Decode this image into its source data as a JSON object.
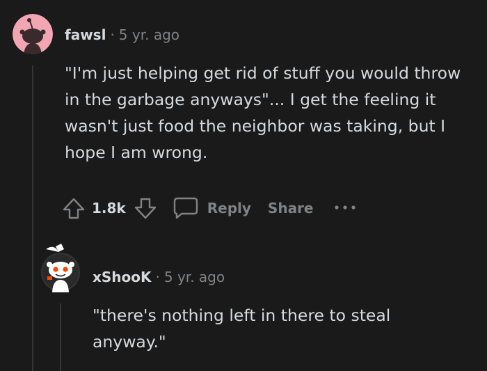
{
  "comments": [
    {
      "username": "fawsl",
      "separator": "·",
      "time": "5 yr. ago",
      "body": "\"I'm just helping get rid of stuff you would throw in the garbage anyways\"... I get the feeling it wasn't just food the neighbor was taking, but I hope I am wrong.",
      "score": "1.8k",
      "reply_label": "Reply",
      "share_label": "Share",
      "avatar_bg": "#f2a5b3",
      "icons": [
        "upvote-icon",
        "downvote-icon",
        "comment-icon",
        "more-icon"
      ]
    },
    {
      "username": "xShooK",
      "separator": "·",
      "time": "5 yr. ago",
      "body": "\"there's nothing left in there to steal anyway.\"",
      "avatar_bg": "#343536"
    }
  ],
  "colors": {
    "background": "#1a1a1b",
    "text": "#d7dadc",
    "muted": "#818384",
    "thread_line": "#343536",
    "snoo_orange": "#ff4500"
  }
}
